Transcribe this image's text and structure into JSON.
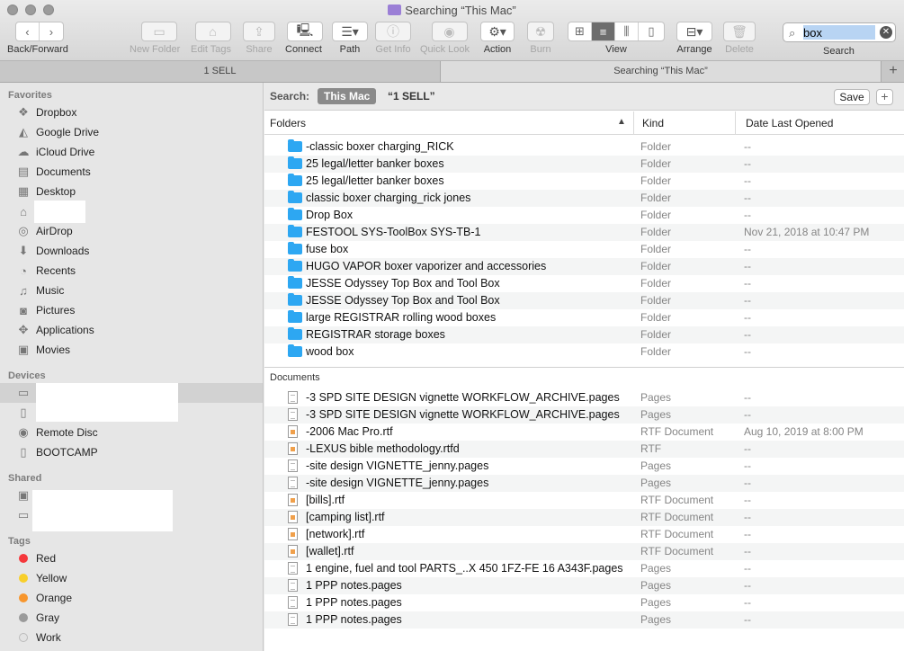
{
  "window": {
    "title": "Searching “This Mac”"
  },
  "toolbar": {
    "back_forward_label": "Back/Forward",
    "new_folder_label": "New Folder",
    "edit_tags_label": "Edit Tags",
    "share_label": "Share",
    "connect_label": "Connect",
    "path_label": "Path",
    "get_info_label": "Get Info",
    "quick_look_label": "Quick Look",
    "action_label": "Action",
    "burn_label": "Burn",
    "view_label": "View",
    "arrange_label": "Arrange",
    "delete_label": "Delete",
    "search_label": "Search",
    "search_value": "box"
  },
  "tabs": [
    {
      "label": "1 SELL"
    },
    {
      "label": "Searching “This Mac”"
    }
  ],
  "sidebar": {
    "favorites_header": "Favorites",
    "favorites": [
      {
        "label": "Dropbox",
        "icon": "dropbox-icon"
      },
      {
        "label": "Google Drive",
        "icon": "google-drive-icon"
      },
      {
        "label": "iCloud Drive",
        "icon": "cloud-icon"
      },
      {
        "label": "Documents",
        "icon": "documents-icon"
      },
      {
        "label": "Desktop",
        "icon": "desktop-icon"
      },
      {
        "label": "",
        "icon": "home-icon"
      },
      {
        "label": "AirDrop",
        "icon": "airdrop-icon"
      },
      {
        "label": "Downloads",
        "icon": "downloads-icon"
      },
      {
        "label": "Recents",
        "icon": "clock-icon"
      },
      {
        "label": "Music",
        "icon": "music-icon"
      },
      {
        "label": "Pictures",
        "icon": "camera-icon"
      },
      {
        "label": "Applications",
        "icon": "applications-icon"
      },
      {
        "label": "Movies",
        "icon": "film-icon"
      }
    ],
    "devices_header": "Devices",
    "devices": [
      {
        "label": "",
        "icon": "laptop-icon"
      },
      {
        "label": "",
        "icon": "disk-icon"
      },
      {
        "label": "Remote Disc",
        "icon": "disc-icon"
      },
      {
        "label": "BOOTCAMP",
        "icon": "disk-icon"
      }
    ],
    "shared_header": "Shared",
    "shared": [
      {
        "label": "",
        "icon": "server-icon"
      },
      {
        "label": "",
        "icon": "drive-icon"
      }
    ],
    "tags_header": "Tags",
    "tags": [
      {
        "label": "Red",
        "color": "#f5383c"
      },
      {
        "label": "Yellow",
        "color": "#f8cf2b"
      },
      {
        "label": "Orange",
        "color": "#f7962d"
      },
      {
        "label": "Gray",
        "color": "#9a9a9a"
      },
      {
        "label": "Work",
        "color": "#e3e3e3"
      }
    ]
  },
  "scope": {
    "label": "Search:",
    "this_mac": "This Mac",
    "other": "“1 SELL”",
    "save_label": "Save",
    "add_label": "+"
  },
  "columns": {
    "name": "Folders",
    "kind": "Kind",
    "date": "Date Last Opened"
  },
  "folders": [
    {
      "name": "-classic boxer charging_RICK",
      "kind": "Folder",
      "date": "--"
    },
    {
      "name": "25 legal/letter banker boxes",
      "kind": "Folder",
      "date": "--"
    },
    {
      "name": "25 legal/letter banker boxes",
      "kind": "Folder",
      "date": "--"
    },
    {
      "name": "classic boxer charging_rick jones",
      "kind": "Folder",
      "date": "--"
    },
    {
      "name": "Drop Box",
      "kind": "Folder",
      "date": "--"
    },
    {
      "name": "FESTOOL SYS-ToolBox SYS-TB-1",
      "kind": "Folder",
      "date": "Nov 21, 2018 at 10:47 PM"
    },
    {
      "name": "fuse box",
      "kind": "Folder",
      "date": "--"
    },
    {
      "name": "HUGO VAPOR boxer vaporizer and accessories",
      "kind": "Folder",
      "date": "--"
    },
    {
      "name": "JESSE Odyssey Top Box and Tool Box",
      "kind": "Folder",
      "date": "--"
    },
    {
      "name": "JESSE Odyssey Top Box and Tool Box",
      "kind": "Folder",
      "date": "--"
    },
    {
      "name": "large REGISTRAR rolling wood boxes",
      "kind": "Folder",
      "date": "--"
    },
    {
      "name": "REGISTRAR storage boxes",
      "kind": "Folder",
      "date": "--"
    },
    {
      "name": "wood box",
      "kind": "Folder",
      "date": "--"
    }
  ],
  "documents_header": "Documents",
  "documents": [
    {
      "name": "-3 SPD SITE DESIGN vignette WORKFLOW_ARCHIVE.pages",
      "kind": "Pages",
      "date": "--",
      "type": "pages"
    },
    {
      "name": "-3 SPD SITE DESIGN vignette WORKFLOW_ARCHIVE.pages",
      "kind": "Pages",
      "date": "--",
      "type": "pages"
    },
    {
      "name": "-2006 Mac Pro.rtf",
      "kind": "RTF Document",
      "date": "Aug 10, 2019 at 8:00 PM",
      "type": "rtf"
    },
    {
      "name": "-LEXUS bible methodology.rtfd",
      "kind": "RTF",
      "date": "--",
      "type": "rtf"
    },
    {
      "name": "-site design VIGNETTE_jenny.pages",
      "kind": "Pages",
      "date": "--",
      "type": "pages"
    },
    {
      "name": "-site design VIGNETTE_jenny.pages",
      "kind": "Pages",
      "date": "--",
      "type": "pages"
    },
    {
      "name": "[bills].rtf",
      "kind": "RTF Document",
      "date": "--",
      "type": "rtf"
    },
    {
      "name": "[camping list].rtf",
      "kind": "RTF Document",
      "date": "--",
      "type": "rtf"
    },
    {
      "name": "[network].rtf",
      "kind": "RTF Document",
      "date": "--",
      "type": "rtf"
    },
    {
      "name": "[wallet].rtf",
      "kind": "RTF Document",
      "date": "--",
      "type": "rtf"
    },
    {
      "name": "1 engine, fuel and tool PARTS_..X 450 1FZ-FE 16 A343F.pages",
      "kind": "Pages",
      "date": "--",
      "type": "pages"
    },
    {
      "name": "1 PPP notes.pages",
      "kind": "Pages",
      "date": "--",
      "type": "pages"
    },
    {
      "name": "1 PPP notes.pages",
      "kind": "Pages",
      "date": "--",
      "type": "pages"
    },
    {
      "name": "1 PPP notes.pages",
      "kind": "Pages",
      "date": "--",
      "type": "pages"
    }
  ]
}
